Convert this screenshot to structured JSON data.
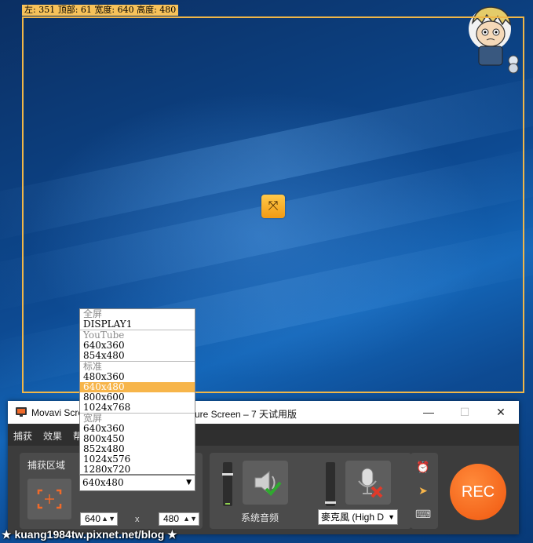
{
  "capture": {
    "coord_text": "左: 351 顶部: 61 宽度: 640 高度: 480"
  },
  "app": {
    "title": "Movavi Scre",
    "title_tail": "ure Screen – 7 天试用版",
    "window_controls": {
      "minimize": "—",
      "maximize": "☐",
      "close": "✕"
    },
    "menu": [
      "捕获",
      "效果",
      "帮"
    ]
  },
  "capture_panel": {
    "title": "捕获区域",
    "width_value": "640",
    "height_value": "480",
    "separator": "x",
    "selected_size": "640x480"
  },
  "size_dropdown": {
    "items": [
      {
        "label": "全屏",
        "type": "header"
      },
      {
        "label": "DISPLAY1",
        "type": "item"
      },
      {
        "label": "YouTube",
        "type": "header",
        "sep": true
      },
      {
        "label": "640x360",
        "type": "item"
      },
      {
        "label": "854x480",
        "type": "item"
      },
      {
        "label": "标准",
        "type": "header",
        "sep": true
      },
      {
        "label": "480x360",
        "type": "item"
      },
      {
        "label": "640x480",
        "type": "item",
        "selected": true
      },
      {
        "label": "800x600",
        "type": "item"
      },
      {
        "label": "1024x768",
        "type": "item"
      },
      {
        "label": "宽屏",
        "type": "header",
        "sep": true
      },
      {
        "label": "640x360",
        "type": "item"
      },
      {
        "label": "800x450",
        "type": "item"
      },
      {
        "label": "852x480",
        "type": "item"
      },
      {
        "label": "1024x576",
        "type": "item"
      },
      {
        "label": "1280x720",
        "type": "item"
      }
    ]
  },
  "audio": {
    "system_label": "系统音频",
    "mic_select": "麥克風 (High D"
  },
  "rec_label": "REC",
  "watermark": "★ kuang1984tw.pixnet.net/blog ★",
  "colors": {
    "accent": "#f7b54a",
    "rec": "#f0570f",
    "panel": "#4b4b4b"
  }
}
